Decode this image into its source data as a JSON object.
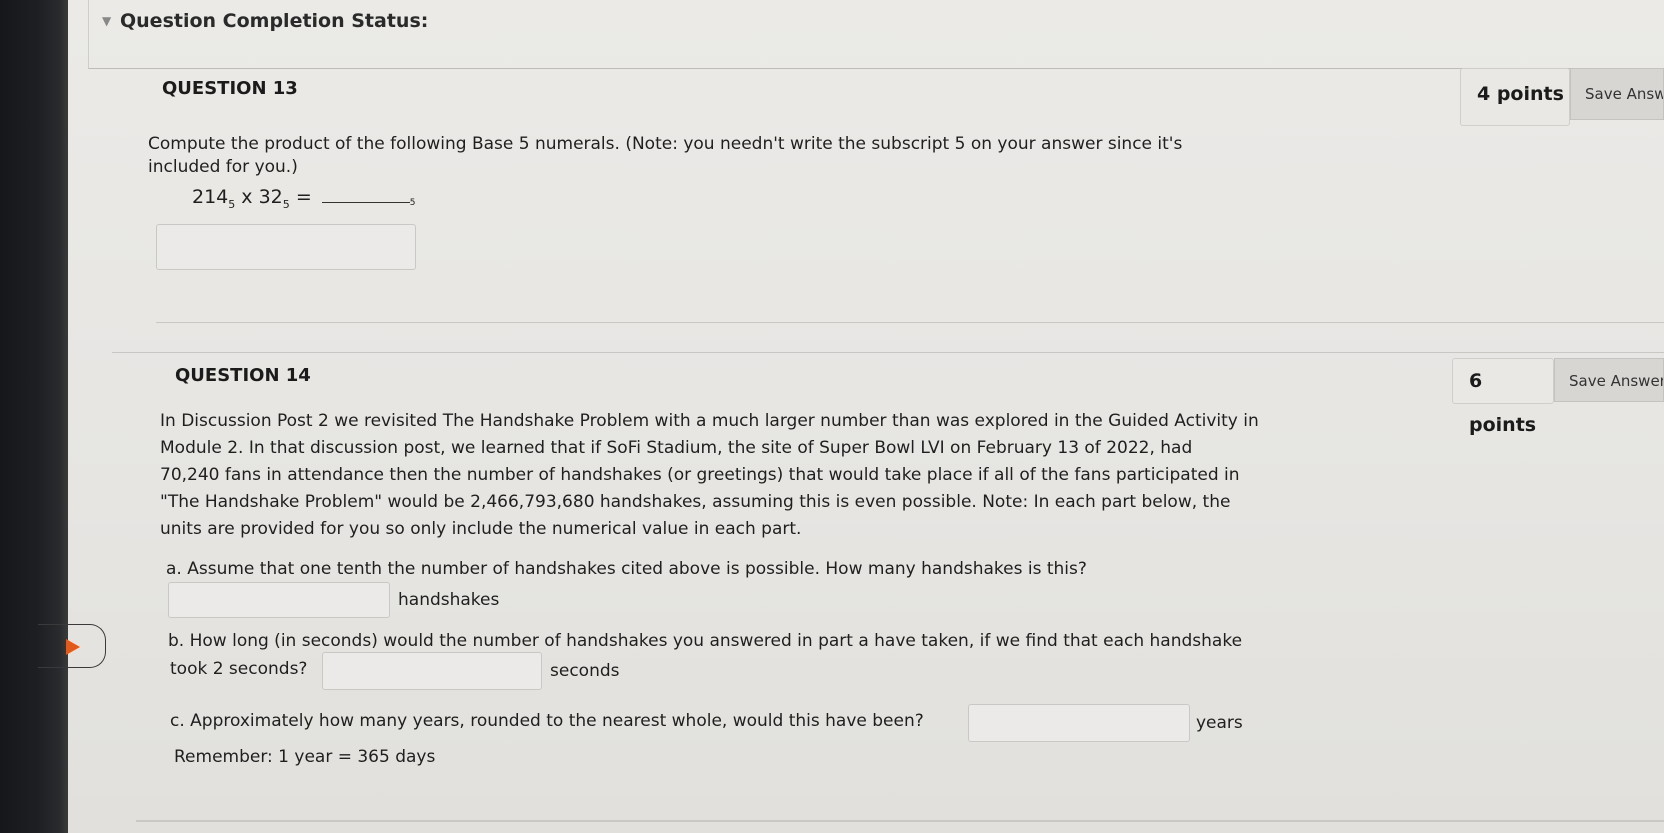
{
  "status": {
    "title": "Question Completion Status:"
  },
  "q13": {
    "title": "QUESTION 13",
    "points": "4 points",
    "save": "Save Answer",
    "prompt_line1": "Compute the product of the following Base 5 numerals. (Note: you needn't write the subscript 5 on your answer since it's",
    "prompt_line2": "included for you.)",
    "eq_a": "214",
    "eq_a_sub": "5",
    "eq_times": " x ",
    "eq_b": "32",
    "eq_b_sub": "5",
    "eq_equals": " =",
    "blank_sub": "5",
    "answer_value": ""
  },
  "q14": {
    "title": "QUESTION 14",
    "points": "6 points",
    "save": "Save Answer",
    "para": [
      "In Discussion Post 2 we revisited The Handshake Problem with a much larger number than was explored in the Guided Activity in",
      "Module 2. In that discussion post, we learned that if SoFi Stadium, the site of Super Bowl LVI on February 13 of 2022, had",
      "70,240 fans in attendance then the number of handshakes (or greetings) that would take place if all of the fans participated in",
      "\"The Handshake Problem\" would be 2,466,793,680 handshakes, assuming this is even possible. Note: In each part below, the",
      "units are provided for you so only include the numerical value in each part."
    ],
    "part_a": {
      "label": "a. Assume that one tenth the number of handshakes cited above is possible. How many handshakes is this?",
      "unit": "handshakes",
      "value": ""
    },
    "part_b": {
      "label_line1": "b. How long (in seconds) would the number of handshakes you answered in part a have taken, if we find that each handshake",
      "label_line2": "took 2 seconds?",
      "unit": "seconds",
      "value": ""
    },
    "part_c": {
      "label": "c. Approximately how many years, rounded to the nearest whole, would this have been?",
      "unit": "years",
      "value": ""
    },
    "remember": "Remember: 1 year = 365 days"
  },
  "colors": {
    "arrow": "#e05a1c"
  }
}
